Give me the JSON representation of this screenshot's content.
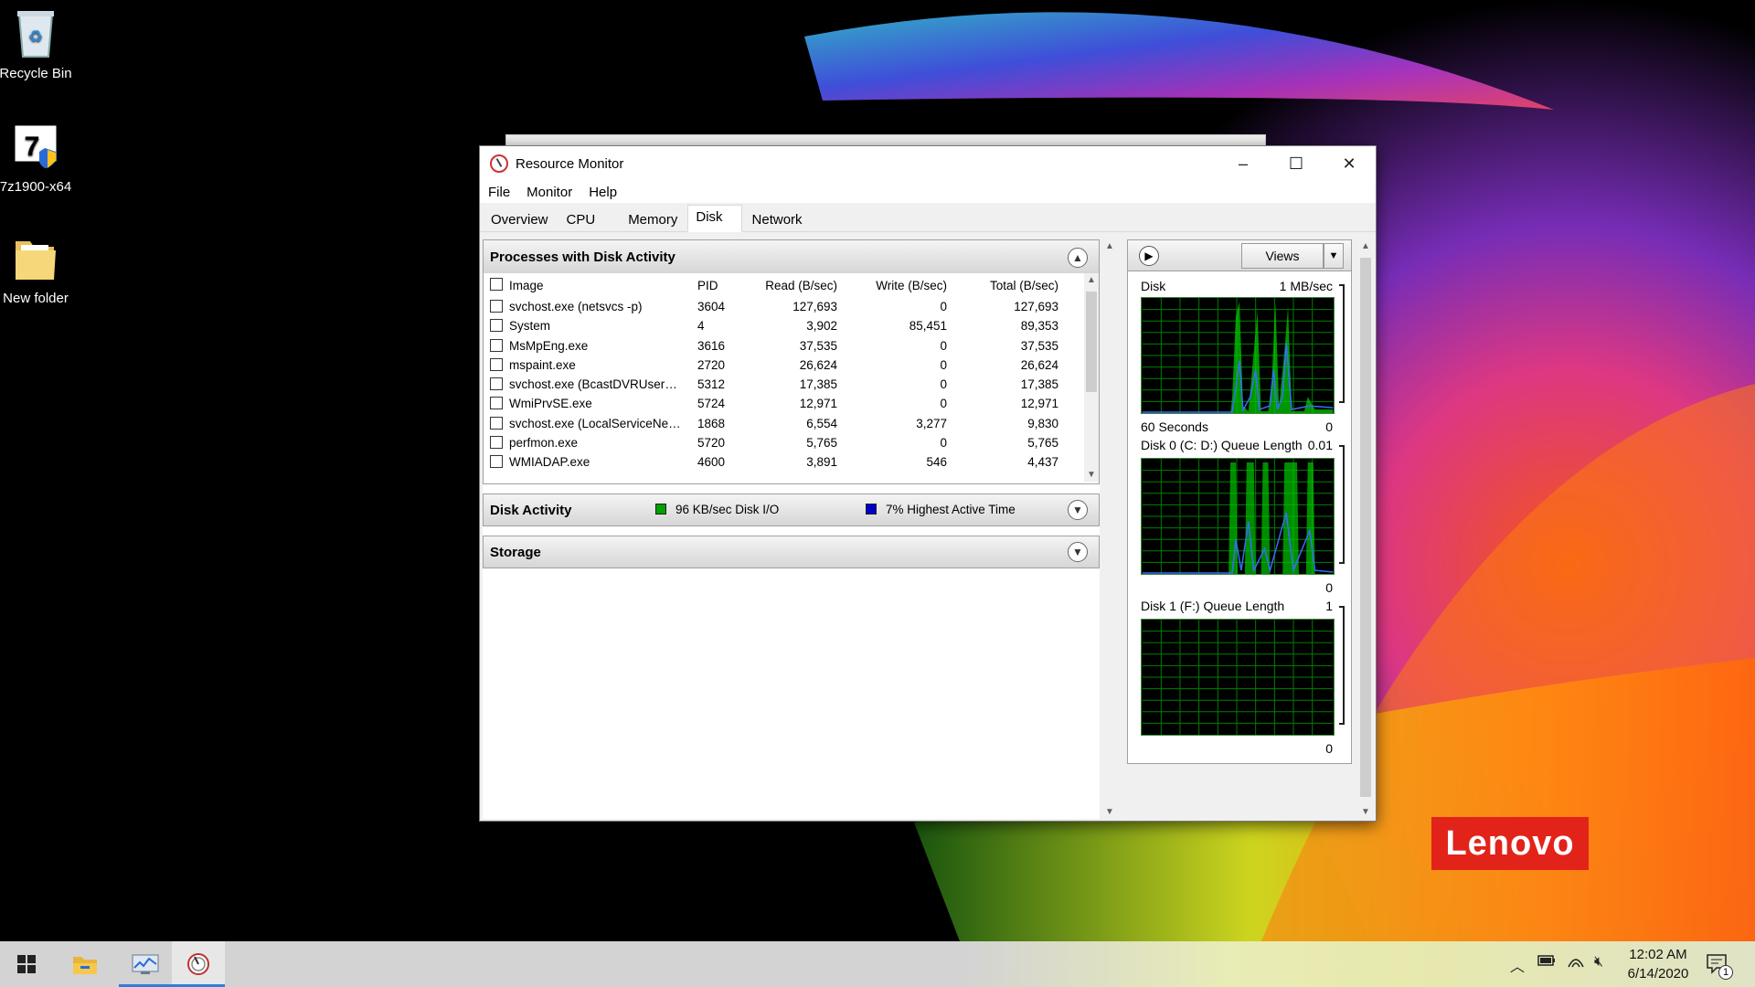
{
  "desktop": {
    "icons": [
      {
        "label": "Recycle Bin"
      },
      {
        "label": "7z1900-x64"
      },
      {
        "label": "New folder"
      }
    ],
    "brand_logo": "Lenovo"
  },
  "window": {
    "title": "Resource Monitor",
    "controls": {
      "minimize": "–",
      "maximize": "☐",
      "close": "✕"
    },
    "menu": [
      "File",
      "Monitor",
      "Help"
    ],
    "tabs": [
      {
        "label": "Overview",
        "active": false
      },
      {
        "label": "CPU",
        "active": false
      },
      {
        "label": "Memory",
        "active": false
      },
      {
        "label": "Disk",
        "active": true
      },
      {
        "label": "Network",
        "active": false
      }
    ]
  },
  "processes": {
    "title": "Processes with Disk Activity",
    "columns": {
      "image": "Image",
      "pid": "PID",
      "read": "Read (B/sec)",
      "write": "Write (B/sec)",
      "total": "Total (B/sec)"
    },
    "rows": [
      {
        "image": "svchost.exe (netsvcs -p)",
        "pid": "3604",
        "read": "127,693",
        "write": "0",
        "total": "127,693"
      },
      {
        "image": "System",
        "pid": "4",
        "read": "3,902",
        "write": "85,451",
        "total": "89,353"
      },
      {
        "image": "MsMpEng.exe",
        "pid": "3616",
        "read": "37,535",
        "write": "0",
        "total": "37,535"
      },
      {
        "image": "mspaint.exe",
        "pid": "2720",
        "read": "26,624",
        "write": "0",
        "total": "26,624"
      },
      {
        "image": "svchost.exe (BcastDVRUserServi...",
        "pid": "5312",
        "read": "17,385",
        "write": "0",
        "total": "17,385"
      },
      {
        "image": "WmiPrvSE.exe",
        "pid": "5724",
        "read": "12,971",
        "write": "0",
        "total": "12,971"
      },
      {
        "image": "svchost.exe (LocalServiceNetwo...",
        "pid": "1868",
        "read": "6,554",
        "write": "3,277",
        "total": "9,830"
      },
      {
        "image": "perfmon.exe",
        "pid": "5720",
        "read": "5,765",
        "write": "0",
        "total": "5,765"
      },
      {
        "image": "WMIADAP.exe",
        "pid": "4600",
        "read": "3,891",
        "write": "546",
        "total": "4,437"
      }
    ]
  },
  "disk_activity": {
    "title": "Disk Activity",
    "io_label": "96 KB/sec Disk I/O",
    "io_color": "#00a000",
    "active_label": "7% Highest Active Time",
    "active_color": "#0000c8"
  },
  "storage": {
    "title": "Storage"
  },
  "graphs": {
    "views_label": "Views",
    "disk": {
      "label": "Disk",
      "max": "1 MB/sec",
      "time": "60 Seconds",
      "min": "0"
    },
    "disk0": {
      "label": "Disk 0 (C: D:) Queue Length",
      "max": "0.01",
      "min": "0"
    },
    "disk1": {
      "label": "Disk 1 (F:) Queue Length",
      "max": "1",
      "min": "0"
    }
  },
  "taskbar": {
    "time": "12:02 AM",
    "date": "6/14/2020",
    "notification_count": "1"
  },
  "colors": {
    "graph_bg": "#000000",
    "graph_grid": "#008000",
    "graph_line": "#00ff00",
    "graph_line2": "#3a6cff",
    "accent": "#2f7ed8"
  }
}
